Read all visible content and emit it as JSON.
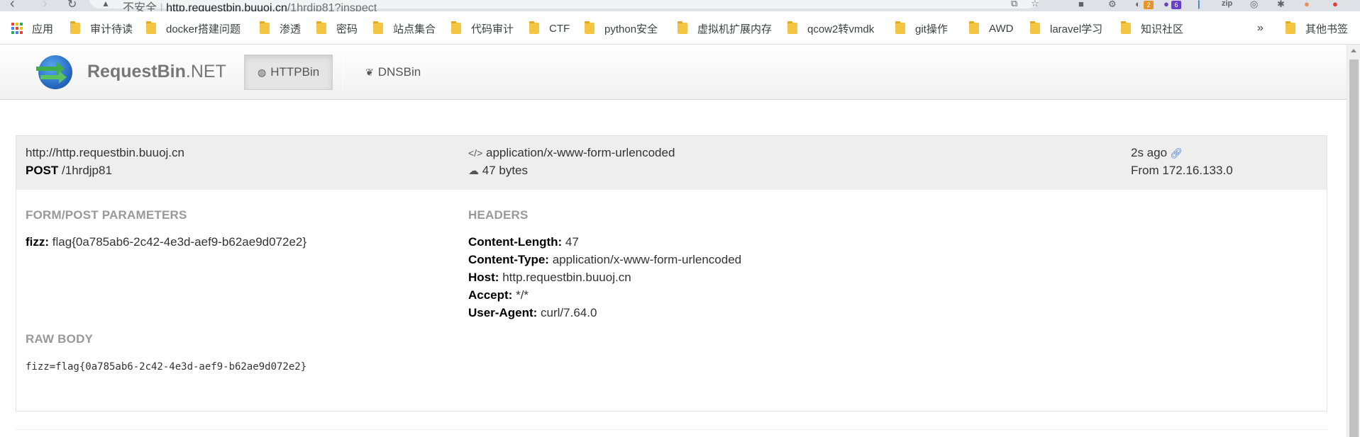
{
  "browser": {
    "security_label": "不安全",
    "url_host": "http.requestbin.buuoj.cn",
    "url_path": "/1hrdjp81?inspect",
    "extension_badges": [
      "2",
      "6"
    ],
    "extension_zip_label": "zip",
    "bookmarks": [
      {
        "label": "应用",
        "icon": "apps-icon"
      },
      {
        "label": "审计待读",
        "icon": "folder-icon"
      },
      {
        "label": "docker搭建问题",
        "icon": "folder-icon"
      },
      {
        "label": "渗透",
        "icon": "folder-icon"
      },
      {
        "label": "密码",
        "icon": "folder-icon"
      },
      {
        "label": "站点集合",
        "icon": "folder-icon"
      },
      {
        "label": "代码审计",
        "icon": "folder-icon"
      },
      {
        "label": "CTF",
        "icon": "folder-icon"
      },
      {
        "label": "python安全",
        "icon": "folder-icon"
      },
      {
        "label": "虚拟机扩展内存",
        "icon": "folder-icon"
      },
      {
        "label": "qcow2转vmdk",
        "icon": "folder-icon"
      },
      {
        "label": "git操作",
        "icon": "folder-icon"
      },
      {
        "label": "AWD",
        "icon": "folder-icon"
      },
      {
        "label": "laravel学习",
        "icon": "folder-icon"
      },
      {
        "label": "知识社区",
        "icon": "folder-icon"
      }
    ],
    "more_bookmarks_glyph": "»",
    "other_bookmarks": "其他书签"
  },
  "site": {
    "brand_main": "RequestBin",
    "brand_suffix": ".NET",
    "nav": [
      {
        "label": "HTTPBin",
        "icon": "globe-icon",
        "active": true
      },
      {
        "label": "DNSBin",
        "icon": "leaf-icon",
        "active": false
      }
    ]
  },
  "request": {
    "url": "http://http.requestbin.buuoj.cn",
    "method": "POST",
    "path": "/1hrdjp81",
    "content_type": "application/x-www-form-urlencoded",
    "size": "47 bytes",
    "time": "2s ago",
    "from": "From 172.16.133.0",
    "form_title": "FORM/POST PARAMETERS",
    "form_params": [
      {
        "key": "fizz:",
        "value": "flag{0a785ab6-2c42-4e3d-aef9-b62ae9d072e2}"
      }
    ],
    "headers_title": "HEADERS",
    "headers": [
      {
        "key": "Content-Length:",
        "value": "47"
      },
      {
        "key": "Content-Type:",
        "value": "application/x-www-form-urlencoded"
      },
      {
        "key": "Host:",
        "value": "http.requestbin.buuoj.cn"
      },
      {
        "key": "Accept:",
        "value": "*/*"
      },
      {
        "key": "User-Agent:",
        "value": "curl/7.64.0"
      }
    ],
    "raw_title": "RAW BODY",
    "raw_body": "fizz=flag{0a785ab6-2c42-4e3d-aef9-b62ae9d072e2}"
  },
  "colors": {
    "accent_link": "#3a7ad3",
    "folder": "#f4c542",
    "panel_head_bg": "#eeeeee"
  }
}
